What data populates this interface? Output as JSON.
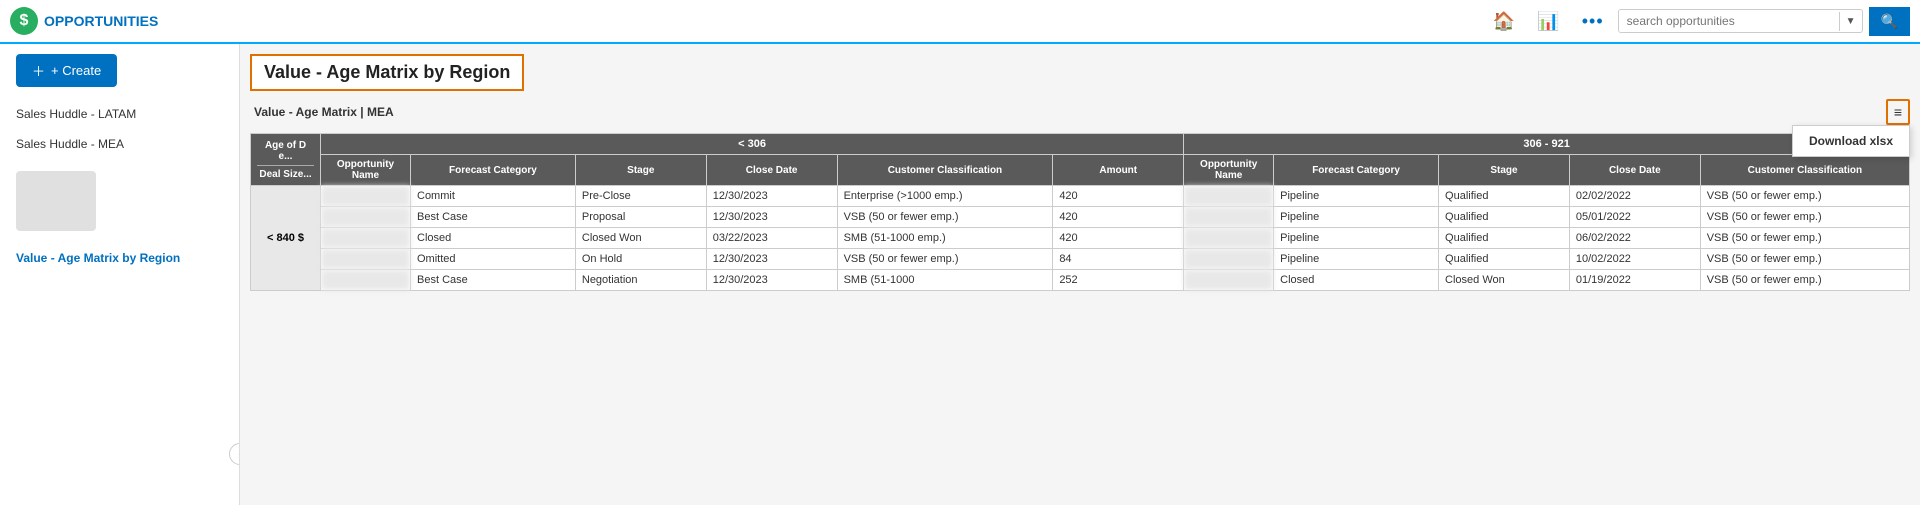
{
  "app": {
    "name": "OPPORTUNITIES"
  },
  "nav": {
    "search_placeholder": "search opportunities",
    "home_icon": "🏠",
    "chart_icon": "📊",
    "more_icon": "•••",
    "search_icon": "🔍"
  },
  "sidebar": {
    "create_label": "+ Create",
    "items": [
      {
        "label": "Sales Huddle - LATAM"
      },
      {
        "label": "Sales Huddle - MEA"
      }
    ],
    "active_item": "Value - Age Matrix by Region",
    "collapse_icon": "‹"
  },
  "content": {
    "page_title": "Value - Age Matrix by Region",
    "sub_header": "Value - Age Matrix | MEA",
    "menu_icon": "≡",
    "download_label": "Download xlsx",
    "table": {
      "corner_line1": "Age of D",
      "corner_line2": "e...",
      "corner_line3": "Deal Size...",
      "col_groups": [
        {
          "label": "< 306",
          "colspan": 6
        },
        {
          "label": "306 - 921",
          "colspan": 5
        }
      ],
      "col_headers": [
        "Opportunity Name",
        "Forecast Category",
        "Stage",
        "Close Date",
        "Customer Classification",
        "Amount",
        "Opportunity Name",
        "Forecast Category",
        "Stage",
        "Close Date",
        "Customer Classification"
      ],
      "row_label": "< 840 $",
      "rows": [
        {
          "opp_name_blurred": true,
          "forecast_category": "Commit",
          "stage": "Pre-Close",
          "close_date": "12/30/2023",
          "customer_class": "Enterprise (>1000 emp.)",
          "amount": "420",
          "opp_name2_blurred": true,
          "forecast_category2": "Pipeline",
          "stage2": "Qualified",
          "close_date2": "02/02/2022",
          "customer_class2": "VSB (50 or fewer emp.)"
        },
        {
          "opp_name_blurred": true,
          "forecast_category": "Best Case",
          "stage": "Proposal",
          "close_date": "12/30/2023",
          "customer_class": "VSB (50 or fewer emp.)",
          "amount": "420",
          "opp_name2_blurred": true,
          "forecast_category2": "Pipeline",
          "stage2": "Qualified",
          "close_date2": "05/01/2022",
          "customer_class2": "VSB (50 or fewer emp.)"
        },
        {
          "opp_name_blurred": true,
          "forecast_category": "Closed",
          "stage": "Closed Won",
          "close_date": "03/22/2023",
          "customer_class": "SMB (51-1000 emp.)",
          "amount": "420",
          "opp_name2_blurred": true,
          "forecast_category2": "Pipeline",
          "stage2": "Qualified",
          "close_date2": "06/02/2022",
          "customer_class2": "VSB (50 or fewer emp.)"
        },
        {
          "opp_name_blurred": true,
          "forecast_category": "Omitted",
          "stage": "On Hold",
          "close_date": "12/30/2023",
          "customer_class": "VSB (50 or fewer emp.)",
          "amount": "84",
          "opp_name2_blurred": true,
          "forecast_category2": "Pipeline",
          "stage2": "Qualified",
          "close_date2": "10/02/2022",
          "customer_class2": "VSB (50 or fewer emp.)"
        },
        {
          "opp_name_blurred": true,
          "forecast_category": "Best Case",
          "stage": "Negotiation",
          "close_date": "12/30/2023",
          "customer_class": "SMB (51-1000",
          "amount": "252",
          "opp_name2_blurred": true,
          "forecast_category2": "Closed",
          "stage2": "Closed Won",
          "close_date2": "01/19/2022",
          "customer_class2": "VSB (50 or fewer emp.)"
        }
      ]
    }
  }
}
